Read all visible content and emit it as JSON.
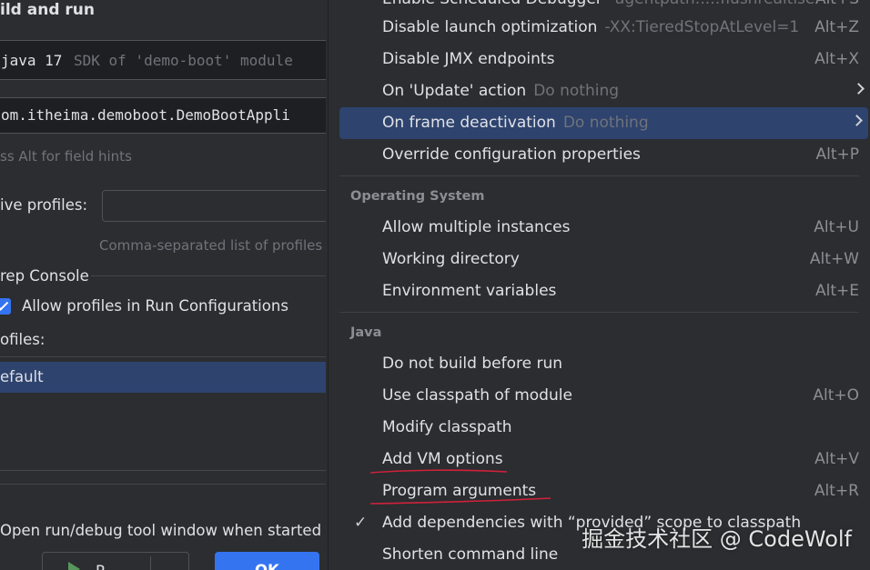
{
  "left": {
    "section_title": "ild and run",
    "jre_field": {
      "java": "java 17",
      "sdk": "SDK of 'demo-boot' module"
    },
    "main_class": "om.itheima.demoboot.DemoBootAppli",
    "field_hint": "ss Alt for field hints",
    "active_profiles_label": "ive profiles:",
    "profiles_hint": "Comma-separated list of profiles",
    "console_group": "rep Console",
    "allow_profiles_checkbox": "Allow profiles in Run Configurations",
    "profiles_label": "ofiles:",
    "profile_default": "efault",
    "open_tool_window": "Open run/debug tool window when started",
    "run_button": "R",
    "ok_button": "OK"
  },
  "menu": {
    "items": [
      {
        "label": "Enable Scheduled Debugger",
        "sub": "-agentpath:...:flushrealtise",
        "shortcut": "Alt+S"
      },
      {
        "label": "Disable launch optimization",
        "sub": "-XX:TieredStopAtLevel=1",
        "shortcut": "Alt+Z"
      },
      {
        "label": "Disable JMX endpoints",
        "sub": "",
        "shortcut": "Alt+X"
      },
      {
        "label": "On 'Update' action",
        "sub": "Do nothing",
        "shortcut": ""
      },
      {
        "label": "On frame deactivation",
        "sub": "Do nothing",
        "shortcut": ""
      },
      {
        "label": "Override configuration properties",
        "sub": "",
        "shortcut": "Alt+P"
      }
    ],
    "os_group": "Operating System",
    "os_items": [
      {
        "label": "Allow multiple instances",
        "shortcut": "Alt+U"
      },
      {
        "label": "Working directory",
        "shortcut": "Alt+W"
      },
      {
        "label": "Environment variables",
        "shortcut": "Alt+E"
      }
    ],
    "java_group": "Java",
    "java_items": [
      {
        "label": "Do not build before run",
        "shortcut": ""
      },
      {
        "label": "Use classpath of module",
        "shortcut": "Alt+O"
      },
      {
        "label": "Modify classpath",
        "shortcut": ""
      },
      {
        "label": "Add VM options",
        "shortcut": "Alt+V"
      },
      {
        "label": "Program arguments",
        "shortcut": "Alt+R"
      },
      {
        "label": "Add dependencies with “provided” scope to classpath",
        "shortcut": ""
      },
      {
        "label": "Shorten command line",
        "shortcut": ""
      }
    ]
  },
  "watermark": "掘金技术社区 @ CodeWolf",
  "colors": {
    "selection": "#2e436e",
    "accent": "#3574f0",
    "annotation": "#d0213b"
  }
}
